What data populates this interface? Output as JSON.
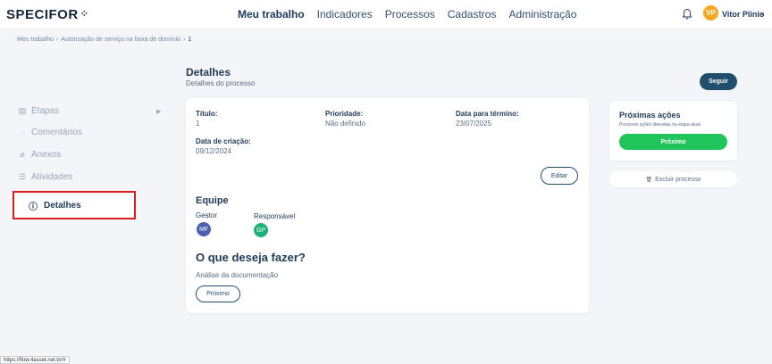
{
  "header": {
    "logo_text": "SPECIFOR",
    "logo_dots": "⁘",
    "nav": [
      "Meu trabalho",
      "Indicadores",
      "Processos",
      "Cadastros",
      "Administração"
    ],
    "user_initials": "VP",
    "user_name": "Vitor Plinio",
    "user_chevron": "⌄"
  },
  "breadcrumb": {
    "items": [
      "Meu trabalho",
      "Autorização de serviço na faixa de domínio",
      "1"
    ],
    "separator": "›"
  },
  "sidebar": {
    "items": [
      {
        "icon": "▤",
        "label": "Etapas"
      },
      {
        "icon": "◌",
        "label": "Comentários"
      },
      {
        "icon": "⌀",
        "label": "Anexos"
      },
      {
        "icon": "☰",
        "label": "Atividades"
      }
    ],
    "expand_arrow": "▶",
    "active": {
      "icon": "ⓘ",
      "label": "Detalhes"
    }
  },
  "page": {
    "title": "Detalhes",
    "subtitle": "Detalhes do processo",
    "follow_label": "Seguir"
  },
  "details": {
    "fields": [
      {
        "label": "Título:",
        "value": "1"
      },
      {
        "label": "Prioridade:",
        "value": "Não definido"
      },
      {
        "label": "Data para término:",
        "value": "23/07/2025"
      },
      {
        "label": "Data de criação:",
        "value": "09/12/2024"
      }
    ],
    "edit_label": "Editar"
  },
  "team": {
    "title": "Equipe",
    "members": [
      {
        "role": "Gestor",
        "initials": "MF",
        "color": "#4a5fb0"
      },
      {
        "role": "Responsável",
        "initials": "GP",
        "color": "#1fb07a"
      }
    ]
  },
  "action": {
    "title": "O que deseja fazer?",
    "step": "Análise da documentação",
    "next_label": "Próximo"
  },
  "next_actions": {
    "title": "Próximas ações",
    "subtitle": "Possíveis ações liberadas na etapa atual",
    "button_label": "Próximo"
  },
  "delete": {
    "icon": "🗑",
    "label": "Excluir processo"
  },
  "status_url": "https://flow.4asset.net.br/#"
}
